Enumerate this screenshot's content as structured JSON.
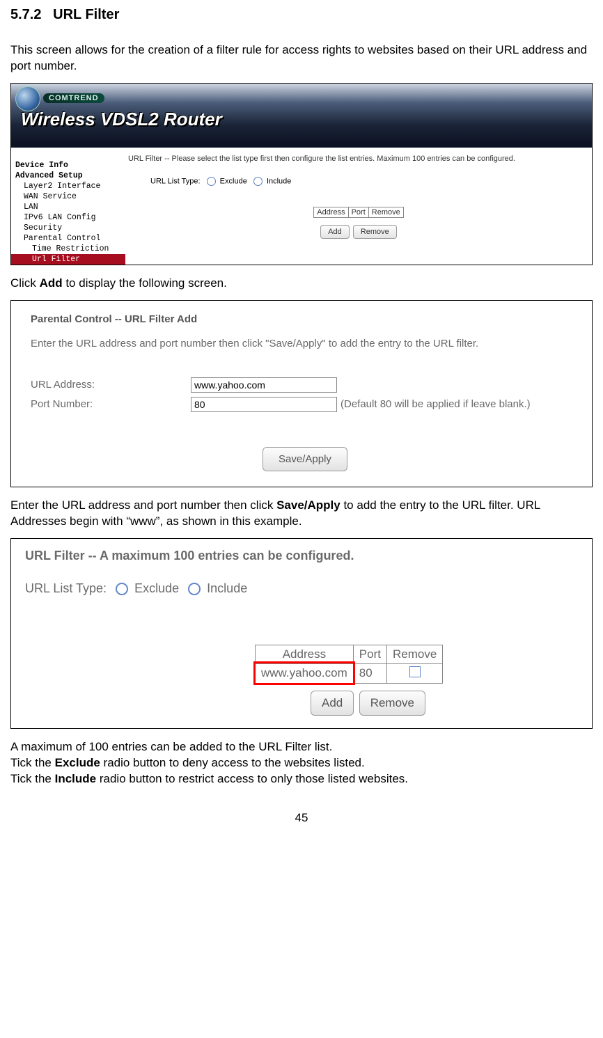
{
  "heading_number": "5.7.2",
  "heading_text": "URL Filter",
  "intro_para": "This screen allows for the creation of a filter rule for access rights to websites based on their URL address and port number.",
  "screenshot1": {
    "brand": "COMTREND",
    "product_title": "Wireless VDSL2 Router",
    "hint_line": "URL Filter -- Please select the list type first then configure the list entries. Maximum 100 entries can be configured.",
    "list_type_label": "URL List Type:",
    "radio_exclude": "Exclude",
    "radio_include": "Include",
    "table_headers": [
      "Address",
      "Port",
      "Remove"
    ],
    "btn_add": "Add",
    "btn_remove": "Remove",
    "sidebar": [
      {
        "label": "Device Info",
        "class": "bold"
      },
      {
        "label": "Advanced Setup",
        "class": "bold"
      },
      {
        "label": "Layer2 Interface",
        "class": "sub"
      },
      {
        "label": "WAN Service",
        "class": "sub"
      },
      {
        "label": "LAN",
        "class": "sub"
      },
      {
        "label": "IPv6 LAN Config",
        "class": "sub"
      },
      {
        "label": "Security",
        "class": "sub"
      },
      {
        "label": "Parental Control",
        "class": "sub"
      },
      {
        "label": "Time Restriction",
        "class": "sub2"
      },
      {
        "label": "Url Filter",
        "class": "sub2 active"
      }
    ]
  },
  "click_add_text_prefix": "Click ",
  "click_add_bold": "Add",
  "click_add_text_suffix": " to display the following screen.",
  "screenshot2": {
    "title": "Parental Control -- URL Filter Add",
    "intro": "Enter the URL address and port number then click \"Save/Apply\" to add the entry to the URL filter.",
    "url_label": "URL Address:",
    "url_value": "www.yahoo.com",
    "port_label": "Port Number:",
    "port_value": "80",
    "port_hint": "(Default 80 will be applied if leave blank.)",
    "save_apply": "Save/Apply"
  },
  "enter_url_prefix": "Enter the URL address and port number then click ",
  "enter_url_bold": "Save/Apply",
  "enter_url_suffix": " to add the entry to the URL filter.   URL Addresses begin with “www”, as shown in this example.",
  "screenshot3": {
    "title": "URL Filter -- A maximum 100 entries can be configured.",
    "list_type_label": "URL List Type:",
    "radio_exclude": "Exclude",
    "radio_include": "Include",
    "table_headers": [
      "Address",
      "Port",
      "Remove"
    ],
    "row": {
      "address": "www.yahoo.com",
      "port": "80"
    },
    "btn_add": "Add",
    "btn_remove": "Remove"
  },
  "max_text": "A maximum of 100 entries can be added to the URL Filter list.",
  "exclude_prefix": "Tick the ",
  "exclude_bold": "Exclude",
  "exclude_suffix": " radio button to deny access to the websites listed.",
  "include_prefix": "Tick the ",
  "include_bold": "Include",
  "include_suffix": " radio button to restrict access to only those listed websites.",
  "page_number": "45"
}
